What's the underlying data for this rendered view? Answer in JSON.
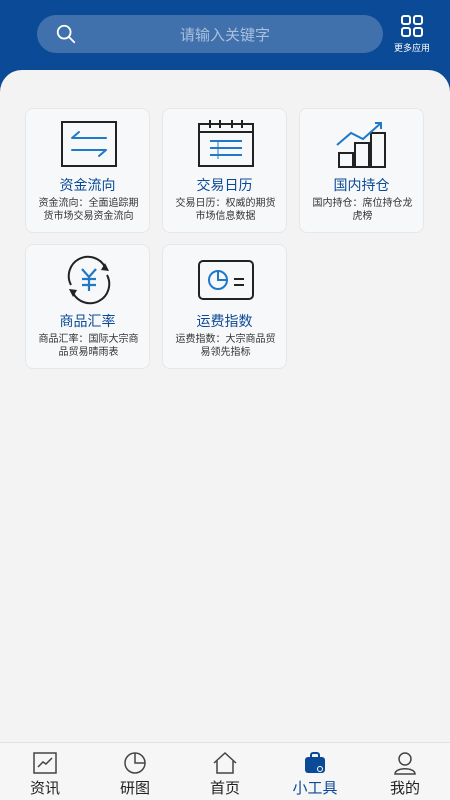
{
  "search": {
    "placeholder": "请输入关键字"
  },
  "more_apps": {
    "label": "更多应用"
  },
  "tools": [
    {
      "icon": "transfer-arrows-icon",
      "title": "资金流向",
      "desc": "资金流向：全面追踪期货市场交易资金流向"
    },
    {
      "icon": "calendar-icon",
      "title": "交易日历",
      "desc": "交易日历：权威的期货市场信息数据"
    },
    {
      "icon": "growth-bars-icon",
      "title": "国内持仓",
      "desc": "国内持仓：席位持仓龙虎榜"
    },
    {
      "icon": "exchange-rate-icon",
      "title": "商品汇率",
      "desc": "商品汇率：国际大宗商品贸易晴雨表"
    },
    {
      "icon": "freight-index-icon",
      "title": "运费指数",
      "desc": "运费指数：大宗商品贸易领先指标"
    }
  ],
  "tabbar": {
    "items": [
      {
        "label": "资讯",
        "icon": "trend-icon"
      },
      {
        "label": "研图",
        "icon": "pie-chart-icon"
      },
      {
        "label": "首页",
        "icon": "home-icon"
      },
      {
        "label": "小工具",
        "icon": "toolbox-icon",
        "active": true
      },
      {
        "label": "我的",
        "icon": "profile-icon"
      }
    ]
  },
  "colors": {
    "brand": "#0b4a96",
    "background": "#f3f3f3"
  }
}
